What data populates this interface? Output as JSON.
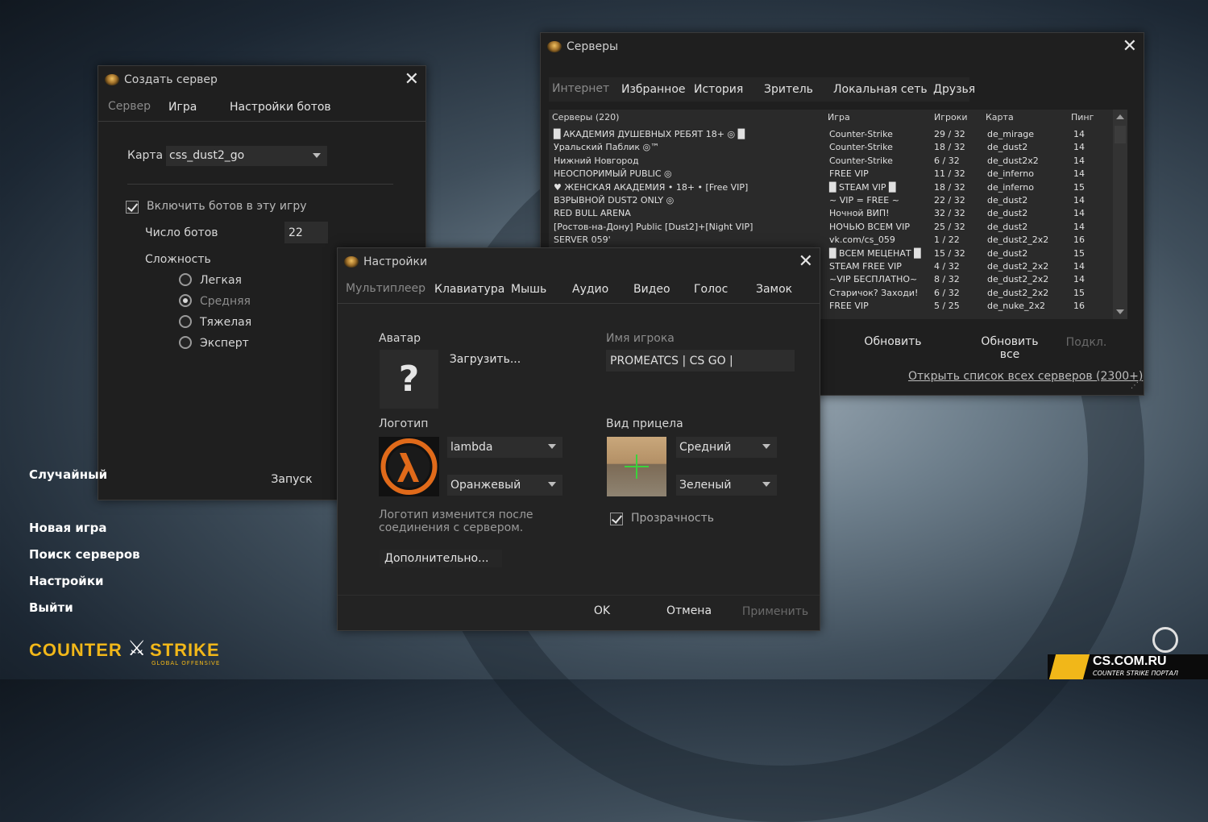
{
  "main_menu": {
    "random": "Случайный",
    "new_game": "Новая игра",
    "find_servers": "Поиск серверов",
    "settings": "Настройки",
    "quit": "Выйти"
  },
  "logo": {
    "cs_text_left": "COUNTER",
    "cs_text_right": "STRIKE",
    "cs_sub": "GLOBAL OFFENSIVE",
    "site": "CS.COM.RU",
    "site_sub": "COUNTER STRIKE ПОРТАЛ"
  },
  "create_server": {
    "title": "Создать сервер",
    "tabs": [
      "Сервер",
      "Игра",
      "Настройки ботов"
    ],
    "map_label": "Карта",
    "map_value": "css_dust2_go",
    "bots_enable_label": "Включить ботов в эту игру",
    "bots_count_label": "Число ботов",
    "bots_count_value": "22",
    "difficulty_label": "Сложность",
    "difficulty_options": [
      "Легкая",
      "Средняя",
      "Тяжелая",
      "Эксперт"
    ],
    "difficulty_selected": 1,
    "start_button": "Запуск"
  },
  "servers": {
    "title": "Серверы",
    "tabs": [
      "Интернет",
      "Избранное",
      "История",
      "Зритель",
      "Локальная сеть",
      "Друзья"
    ],
    "columns": [
      "Серверы (220)",
      "Игра",
      "Игроки",
      "Карта",
      "Пинг"
    ],
    "rows": [
      [
        "█ АКАДЕМИЯ ДУШЕВНЫХ РЕБЯТ 18+ ◎ █",
        "Counter-Strike",
        "29 / 32",
        "de_mirage",
        "14"
      ],
      [
        "Уральский Паблик ◎™",
        "Counter-Strike",
        "18 / 32",
        "de_dust2",
        "14"
      ],
      [
        "Нижний Новгород",
        "Counter-Strike",
        "6 / 32",
        "de_dust2x2",
        "14"
      ],
      [
        "НЕОСПОРИМЫЙ PUBLIC ◎",
        "FREE VIP",
        "11 / 32",
        "de_inferno",
        "14"
      ],
      [
        "♥ ЖЕНСКАЯ АКАДЕМИЯ • 18+ • [Free VIP]",
        "█ STEAM VIP █",
        "18 / 32",
        "de_inferno",
        "15"
      ],
      [
        "ВЗРЫВНОЙ DUST2 ONLY ◎",
        "~ VIP = FREE ~",
        "22 / 32",
        "de_dust2",
        "14"
      ],
      [
        "RED BULL ARENA",
        "Ночной ВИП!",
        "32 / 32",
        "de_dust2",
        "14"
      ],
      [
        "[Ростов-на-Дону] Public [Dust2]+[Night VIP]",
        "НОЧЬЮ ВСЕМ VIP",
        "25 / 32",
        "de_dust2",
        "14"
      ],
      [
        "SERVER 059'",
        "vk.com/cs_059",
        "1 / 22",
        "de_dust2_2x2",
        "16"
      ],
      [
        "",
        "█ ВСЕМ МЕЦЕНАТ █",
        "15 / 32",
        "de_dust2",
        "15"
      ],
      [
        "",
        "STEAM FREE VIP",
        "4 / 32",
        "de_dust2_2x2",
        "14"
      ],
      [
        "",
        "~VIP БЕСПЛАТНО~",
        "8 / 32",
        "de_dust2_2x2",
        "14"
      ],
      [
        "",
        "Старичок? Заходи!",
        "6 / 32",
        "de_dust2_2x2",
        "15"
      ],
      [
        "",
        "FREE VIP",
        "5 / 25",
        "de_nuke_2x2",
        "16"
      ]
    ],
    "refresh_button": "Обновить",
    "refresh_all_button": "Обновить все",
    "connect_button": "Подкл.",
    "open_all_link": "Открыть список всех серверов (2300+)"
  },
  "settings": {
    "title": "Настройки",
    "tabs": [
      "Мультиплеер",
      "Клавиатура",
      "Мышь",
      "Аудио",
      "Видео",
      "Голос",
      "Замок"
    ],
    "avatar_label": "Аватар",
    "avatar_placeholder": "?",
    "upload_button": "Загрузить...",
    "player_name_label": "Имя игрока",
    "player_name_value": "PROMEATCS | CS GO |",
    "logo_label": "Логотип",
    "logo_value": "lambda",
    "logo_color_value": "Оранжевый",
    "logo_note": "Логотип изменится после соединения с сервером.",
    "crosshair_label": "Вид прицела",
    "crosshair_size_value": "Средний",
    "crosshair_color_value": "Зеленый",
    "transparency_label": "Прозрачность",
    "advanced_button": "Дополнительно...",
    "ok_button": "OK",
    "cancel_button": "Отмена",
    "apply_button": "Применить"
  },
  "colors": {
    "lambda_orange": "#e06a1a",
    "crosshair_green": "#3cd23c",
    "cs_logo_yellow": "#f1b719"
  }
}
